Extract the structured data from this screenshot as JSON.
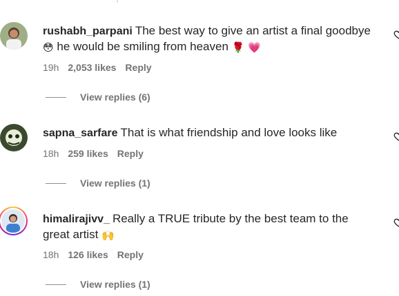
{
  "comments": [
    {
      "username": "rushabh_parpani",
      "text_line1": "The best way to give an artist a final goodbye",
      "text_line2": "he would be smiling from heaven",
      "emoji_a": "😳",
      "emoji_b": "🌹",
      "emoji_c": "💗",
      "time": "19h",
      "likes": "2,053 likes",
      "reply": "Reply",
      "view_replies": "View replies (6)"
    },
    {
      "username": "sapna_sarfare",
      "text_line1": "That is what friendship and love looks like",
      "time": "18h",
      "likes": "259 likes",
      "reply": "Reply",
      "view_replies": "View replies (1)"
    },
    {
      "username": "himalirajivv_",
      "text_line1": "Really a TRUE tribute by the best team to the",
      "text_line2": "great artist",
      "emoji_a": "🙌",
      "time": "18h",
      "likes": "126 likes",
      "reply": "Reply",
      "view_replies": "View replies (1)"
    }
  ],
  "icons": {
    "like": "heart-icon"
  },
  "colors": {
    "text": "#262626",
    "secondary": "#737373",
    "background": "#ffffff"
  }
}
